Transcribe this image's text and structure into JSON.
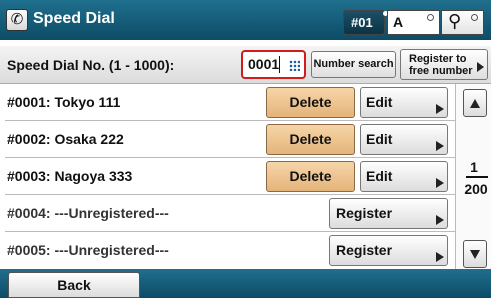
{
  "header": {
    "title": "Speed Dial",
    "icon": "speed-dial-app-icon",
    "number_display": "#01",
    "input_mode": "A",
    "search_icon": "search-icon",
    "bar_color": "#0d4c66"
  },
  "speed_dial_bar": {
    "label": "Speed Dial No. (1 - 1000):",
    "input_value": "0001",
    "number_search_label": "Number search",
    "register_free_line1": "Register to",
    "register_free_line2": "free number"
  },
  "entries": [
    {
      "label": "#0001: Tokyo 111",
      "registered": true,
      "delete_label": "Delete",
      "edit_label": "Edit"
    },
    {
      "label": "#0002: Osaka 222",
      "registered": true,
      "delete_label": "Delete",
      "edit_label": "Edit"
    },
    {
      "label": "#0003: Nagoya 333",
      "registered": true,
      "delete_label": "Delete",
      "edit_label": "Edit"
    },
    {
      "label": "#0004: ---Unregistered---",
      "registered": false,
      "register_label": "Register"
    },
    {
      "label": "#0005: ---Unregistered---",
      "registered": false,
      "register_label": "Register"
    }
  ],
  "pagination": {
    "current": "1",
    "total": "200"
  },
  "footer": {
    "back_label": "Back"
  },
  "colors": {
    "accent_delete": "#e4b47a",
    "input_border": "#d01c1c"
  }
}
